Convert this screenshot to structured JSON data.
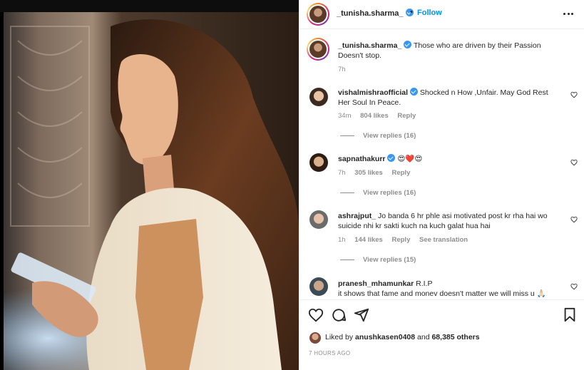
{
  "post": {
    "username": "_tunisha.sharma_",
    "separator": "•",
    "follow_label": "Follow",
    "caption_line1": "Those who are driven by their Passion",
    "caption_line2": "Doesn't stop.",
    "caption_time": "7h",
    "icons": {
      "more": "more-options-icon",
      "verified": "verified-badge-icon"
    }
  },
  "comments": [
    {
      "username": "vishalmishraofficial",
      "verified": true,
      "text_line1": "Shocked n How ,Unfair. May God Rest",
      "text_line2": "Her Soul In Peace.",
      "time": "34m",
      "likes": "804 likes",
      "reply": "Reply",
      "view_replies": "View replies (16)"
    },
    {
      "username": "sapnathakurr",
      "verified": true,
      "text_line1": "😍❤️😍",
      "time": "7h",
      "likes": "305 likes",
      "reply": "Reply",
      "view_replies": "View replies (16)"
    },
    {
      "username": "ashrajput_",
      "verified": false,
      "text_line1": "Jo banda 6 hr phle asi motivated post kr rha hai wo",
      "text_line2": "suicide nhi kr sakti kuch na kuch galat hua hai",
      "time": "1h",
      "likes": "144 likes",
      "reply": "Reply",
      "translate": "See translation",
      "view_replies": "View replies (15)"
    },
    {
      "username": "pranesh_mhamunkar",
      "verified": false,
      "text_line1": "R.I.P",
      "text_line2": "it shows that fame and monev doesn't matter we will miss u 🙏🏻"
    }
  ],
  "actions": {
    "icons": [
      "like-heart-icon",
      "comment-icon",
      "share-icon",
      "save-bookmark-icon"
    ],
    "liked_by_prefix": "Liked by",
    "liked_by_user": "anushkasen0408",
    "liked_by_and": "and",
    "liked_by_others": "68,385 others",
    "timestamp": "7 HOURS AGO"
  }
}
